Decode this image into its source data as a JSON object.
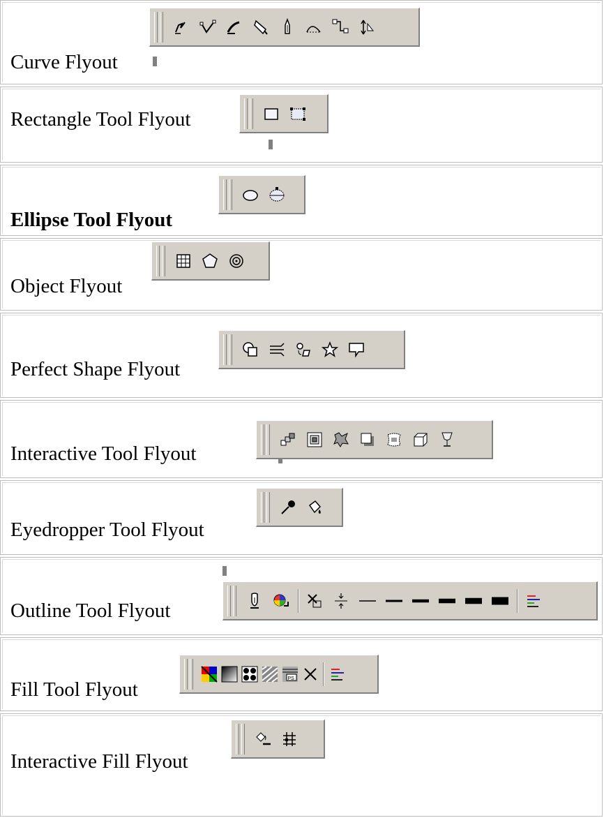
{
  "rows": [
    {
      "label": "Curve Flyout",
      "icons": [
        "freehand-icon",
        "bezier-icon",
        "artistic-media-icon",
        "pen-icon",
        "polyline-icon",
        "three-point-curve-icon",
        "interactive-connector-icon",
        "dimension-icon"
      ]
    },
    {
      "label": "Rectangle Tool Flyout",
      "icons": [
        "rectangle-icon",
        "three-point-rectangle-icon"
      ]
    },
    {
      "label": "Ellipse Tool Flyout",
      "icons": [
        "ellipse-icon",
        "three-point-ellipse-icon"
      ]
    },
    {
      "label": "Object Flyout",
      "icons": [
        "graph-paper-icon",
        "polygon-icon",
        "spiral-icon"
      ]
    },
    {
      "label": "Perfect Shape Flyout",
      "icons": [
        "basic-shapes-icon",
        "arrow-shapes-icon",
        "flowchart-shapes-icon",
        "star-shapes-icon",
        "callout-shapes-icon"
      ]
    },
    {
      "label": "Interactive Tool Flyout",
      "icons": [
        "blend-icon",
        "contour-icon",
        "distort-icon",
        "drop-shadow-icon",
        "envelope-icon",
        "extrude-icon",
        "transparency-icon"
      ]
    },
    {
      "label": "Eyedropper Tool Flyout",
      "icons": [
        "eyedropper-icon",
        "paintbucket-icon"
      ]
    },
    {
      "label": "Outline Tool Flyout",
      "icons": [
        "outline-pen-icon",
        "outline-color-icon",
        "no-outline-icon",
        "hairline-outline-icon",
        "line-weight-1-icon",
        "line-weight-2-icon",
        "line-weight-3-icon",
        "line-weight-4-icon",
        "line-weight-5-icon",
        "line-weight-6-icon",
        "color-docker-icon"
      ]
    },
    {
      "label": "Fill Tool Flyout",
      "icons": [
        "fill-color-icon",
        "fountain-fill-icon",
        "pattern-fill-icon",
        "texture-fill-icon",
        "postscript-fill-icon",
        "no-fill-icon",
        "color-docker-icon"
      ]
    },
    {
      "label": "Interactive Fill Flyout",
      "icons": [
        "interactive-fill-icon",
        "mesh-fill-icon"
      ]
    }
  ]
}
